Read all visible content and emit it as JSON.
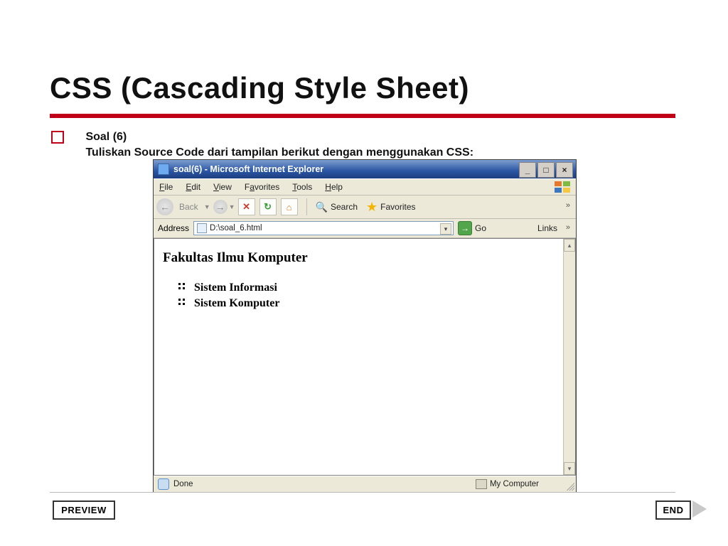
{
  "slide": {
    "title": "CSS (Cascading Style Sheet)",
    "bullet": {
      "heading": "Soal (6)",
      "body": "Tuliskan Source Code dari tampilan berikut dengan menggunakan CSS:"
    },
    "nav": {
      "prev": "PREVIEW",
      "end": "END"
    }
  },
  "ie": {
    "title": "soal(6) - Microsoft Internet Explorer",
    "menu": {
      "file": "File",
      "edit": "Edit",
      "view": "View",
      "fav": "Favorites",
      "tools": "Tools",
      "help": "Help"
    },
    "toolbar": {
      "back": "Back",
      "search": "Search",
      "favorites": "Favorites"
    },
    "address": {
      "label": "Address",
      "value": "D:\\soal_6.html",
      "go": "Go",
      "links": "Links"
    },
    "page": {
      "heading": "Fakultas Ilmu Komputer",
      "items": [
        "Sistem Informasi",
        "Sistem Komputer"
      ]
    },
    "status": {
      "done": "Done",
      "zone": "My Computer"
    }
  }
}
